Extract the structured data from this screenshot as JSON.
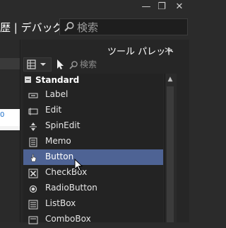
{
  "window": {
    "minimize_glyph": "—",
    "restore_glyph": "❐",
    "close_glyph": "✕"
  },
  "menu": {
    "fragment": "歴 | デバッグ"
  },
  "search": {
    "placeholder": "検索"
  },
  "editor": {
    "line_number": "0"
  },
  "tool_palette": {
    "title": "ツール パレット",
    "collapse_glyph": "≫",
    "search_placeholder": "検索",
    "category": "Standard",
    "selected_item": "Button",
    "items": [
      {
        "label": "Label",
        "icon": "label-icon"
      },
      {
        "label": "Edit",
        "icon": "edit-icon"
      },
      {
        "label": "SpinEdit",
        "icon": "spinedit-icon"
      },
      {
        "label": "Memo",
        "icon": "memo-icon"
      },
      {
        "label": "Button",
        "icon": "button-icon"
      },
      {
        "label": "CheckBox",
        "icon": "checkbox-icon"
      },
      {
        "label": "RadioButton",
        "icon": "radiobutton-icon"
      },
      {
        "label": "ListBox",
        "icon": "listbox-icon"
      },
      {
        "label": "ComboBox",
        "icon": "combobox-icon"
      }
    ]
  },
  "colors": {
    "selection": "#4e6394",
    "background": "#2b2b2b"
  }
}
